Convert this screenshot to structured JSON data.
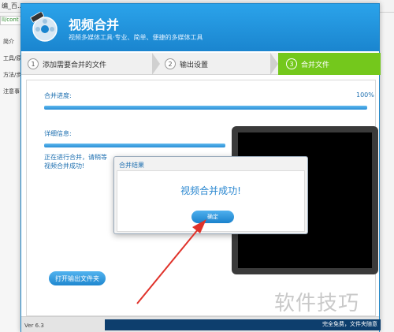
{
  "background": {
    "tabs": [
      "编_百...",
      "",
      ""
    ],
    "url_text": "ll/cont",
    "side_items": [
      "简介",
      "工具/原",
      "方法/步",
      "注意事"
    ]
  },
  "app": {
    "title": "视频合并",
    "subtitle": "视频多媒体工具·专业、简单、便捷的多媒体工具",
    "accent": "#1a85cf",
    "step_active_color": "#74c81c"
  },
  "steps": [
    {
      "num": "1",
      "label": "添加需要合并的文件"
    },
    {
      "num": "2",
      "label": "输出设置"
    },
    {
      "num": "3",
      "label": "合并文件"
    }
  ],
  "progress": {
    "total_label": "合并进度:",
    "total_percent": "100%",
    "total_value": 1.0,
    "detail_label": "详细信息:",
    "detail_value": 1.0,
    "status_lines": [
      "正在进行合并，请稍等",
      "视频合并成功!"
    ]
  },
  "buttons": {
    "open_output": "打开输出文件夹"
  },
  "footer": {
    "version": "Ver 6.3",
    "text": "完全免费，文件夹随意"
  },
  "dialog": {
    "title": "合并结果",
    "message": "视频合并成功!",
    "ok_label": "确定"
  },
  "watermark": "软件技巧",
  "icons": {
    "logo": "video-reel-icon",
    "arrow": "red-annotation-arrow"
  }
}
